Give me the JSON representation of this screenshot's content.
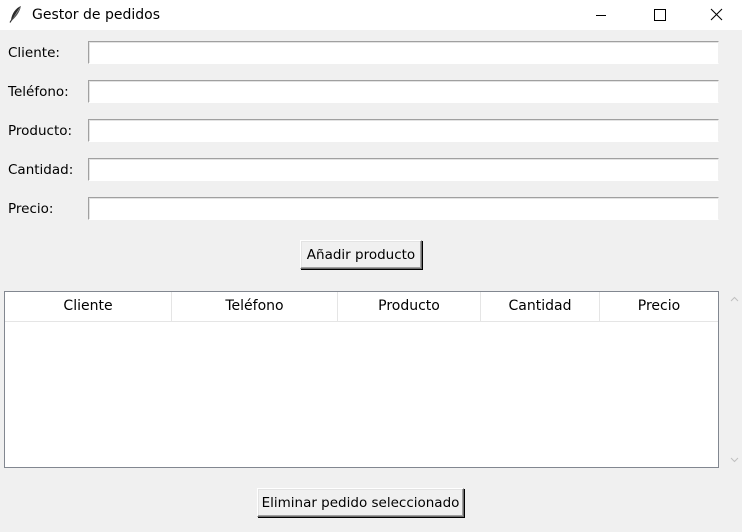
{
  "window": {
    "title": "Gestor de pedidos",
    "icon": "feather-icon"
  },
  "form": {
    "fields": [
      {
        "label": "Cliente:",
        "value": ""
      },
      {
        "label": "Teléfono:",
        "value": ""
      },
      {
        "label": "Producto:",
        "value": ""
      },
      {
        "label": "Cantidad:",
        "value": ""
      },
      {
        "label": "Precio:",
        "value": ""
      }
    ],
    "add_button_label": "Añadir producto"
  },
  "table": {
    "columns": [
      "Cliente",
      "Teléfono",
      "Producto",
      "Cantidad",
      "Precio"
    ],
    "rows": []
  },
  "delete_button_label": "Eliminar pedido seleccionado",
  "colors": {
    "window_background": "#f0f0f0",
    "titlebar_background": "#ffffff",
    "input_background": "#ffffff",
    "table_border": "#828790"
  }
}
